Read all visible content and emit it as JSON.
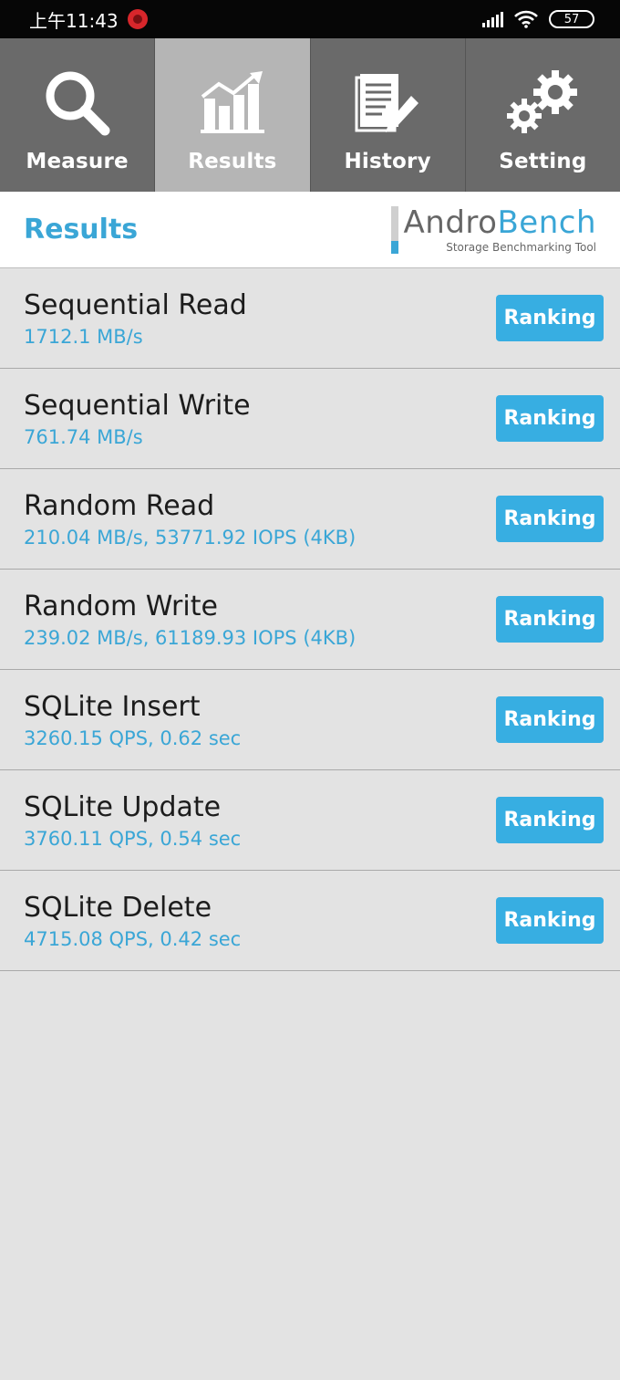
{
  "status_bar": {
    "time": "上午11:43",
    "battery": "57"
  },
  "tabs": [
    {
      "label": "Measure",
      "icon": "search-icon",
      "active": false
    },
    {
      "label": "Results",
      "icon": "chart-icon",
      "active": true
    },
    {
      "label": "History",
      "icon": "document-edit-icon",
      "active": false
    },
    {
      "label": "Setting",
      "icon": "gear-icon",
      "active": false
    }
  ],
  "header": {
    "title": "Results",
    "logo_andro": "Andro",
    "logo_bench": "Bench",
    "logo_subtitle": "Storage Benchmarking Tool"
  },
  "results": [
    {
      "name": "Sequential Read",
      "value": "1712.1 MB/s",
      "button": "Ranking"
    },
    {
      "name": "Sequential Write",
      "value": "761.74 MB/s",
      "button": "Ranking"
    },
    {
      "name": "Random Read",
      "value": "210.04 MB/s, 53771.92 IOPS (4KB)",
      "button": "Ranking"
    },
    {
      "name": "Random Write",
      "value": "239.02 MB/s, 61189.93 IOPS (4KB)",
      "button": "Ranking"
    },
    {
      "name": "SQLite Insert",
      "value": "3260.15 QPS, 0.62 sec",
      "button": "Ranking"
    },
    {
      "name": "SQLite Update",
      "value": "3760.11 QPS, 0.54 sec",
      "button": "Ranking"
    },
    {
      "name": "SQLite Delete",
      "value": "4715.08 QPS, 0.42 sec",
      "button": "Ranking"
    }
  ],
  "colors": {
    "accent": "#3aa6d6",
    "button": "#37aee2",
    "tab_bar": "#6a6a6a",
    "tab_active": "#b5b5b5",
    "list_bg": "#e3e3e3"
  }
}
